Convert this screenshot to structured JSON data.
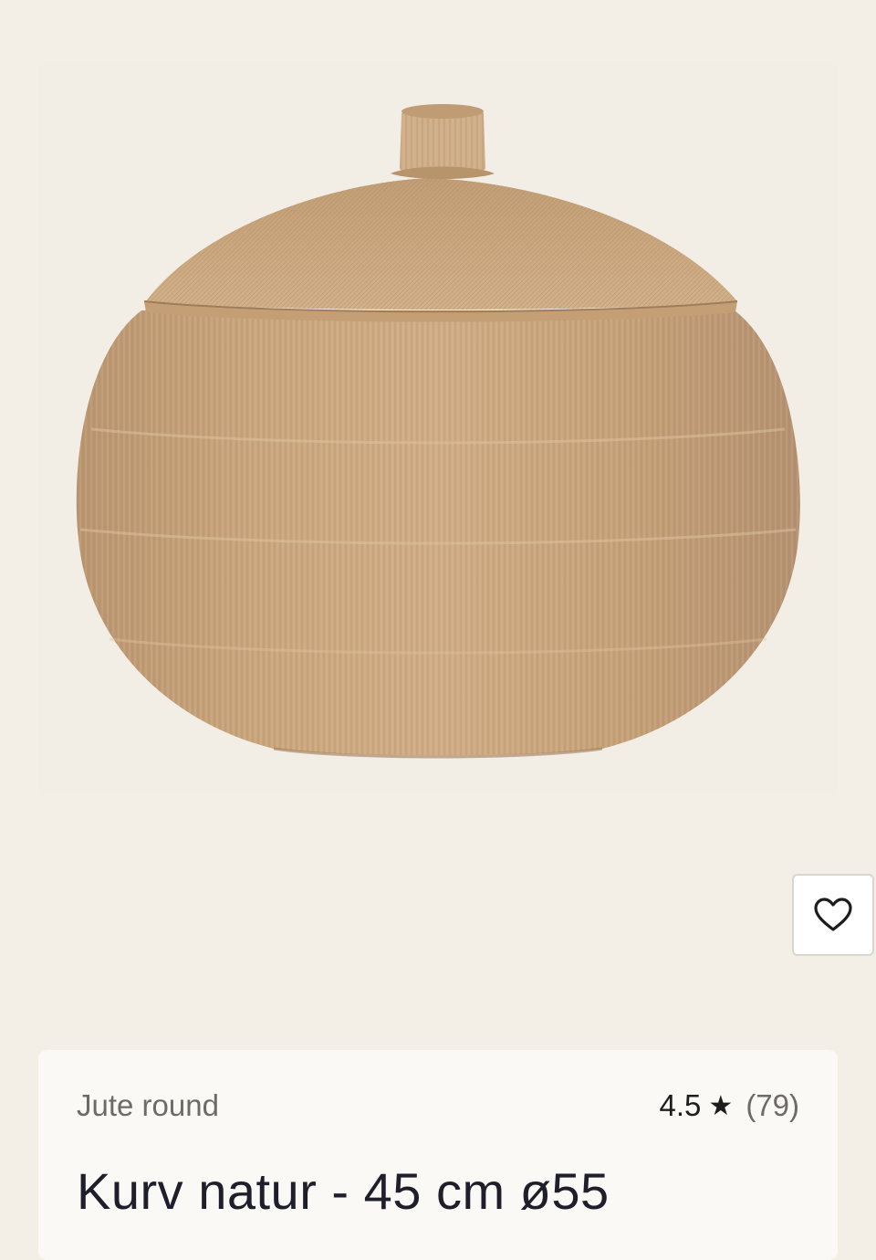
{
  "product": {
    "image_alt": "Kurv natur - 45 cm ø55",
    "brand": "Jute round",
    "rating": {
      "score": "4.5",
      "star_icon": "star-icon",
      "review_count": "(79)"
    },
    "title": "Kurv natur - 45 cm ø55"
  },
  "wishlist": {
    "icon": "heart-icon",
    "aria_label": "Favorit"
  },
  "colors": {
    "background": "#f3efe7",
    "card": "#fbf9f5",
    "jute": "#c9a57c",
    "text": "#1f1f2b",
    "muted": "#6e6a66"
  }
}
